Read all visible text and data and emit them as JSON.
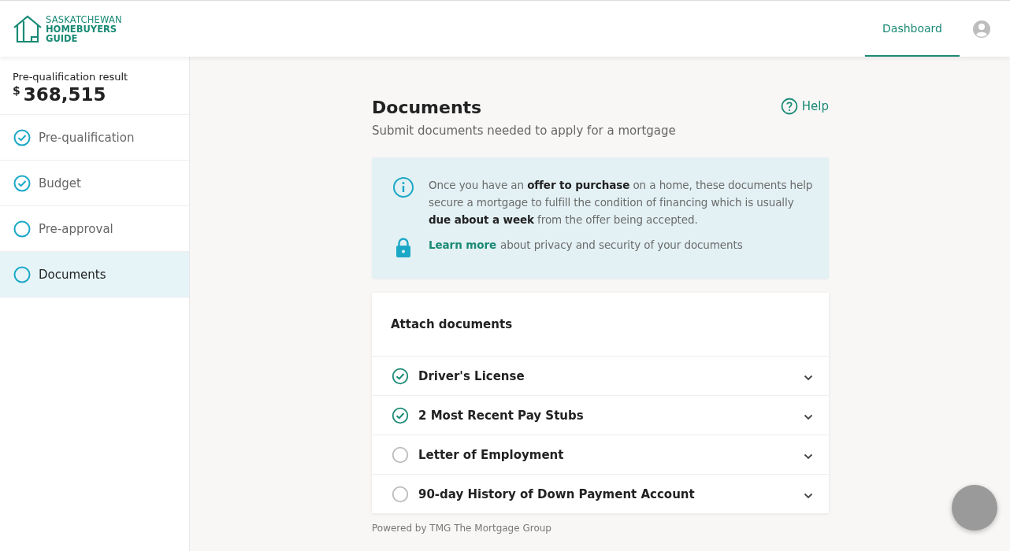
{
  "brand": {
    "line_1": "SASKATCHEWAN",
    "line_2": "HOMEBUYERS",
    "line_3": "GUIDE"
  },
  "nav": [
    {
      "label": "Dashboard",
      "selected": true
    }
  ],
  "sidebar": {
    "result_label": "Pre-qualification result",
    "currency": "$",
    "amount": "368,515",
    "items": [
      {
        "label": "Pre-qualification",
        "done": true,
        "selected": false
      },
      {
        "label": "Budget",
        "done": true,
        "selected": false
      },
      {
        "label": "Pre-approval",
        "done": false,
        "selected": false
      },
      {
        "label": "Documents",
        "done": false,
        "selected": true
      }
    ]
  },
  "page": {
    "title": "Documents",
    "subtitle": "Submit documents needed to apply for a mortgage",
    "help": "Help"
  },
  "notice": {
    "text": "Once you have an **offer to purchase** on a home, these documents help secure a mortgage to fulfill the condition of financing which is usually **due about a week** from the offer being accepted.",
    "link": "Learn more",
    "link_text": "about privacy and security of your documents"
  },
  "attach": {
    "title": "Attach documents",
    "items": [
      {
        "label": "Driver's License",
        "done": true
      },
      {
        "label": "2 Most Recent Pay Stubs",
        "done": true
      },
      {
        "label": "Letter of Employment",
        "done": false
      },
      {
        "label": "90-day History of Down Payment Account",
        "done": false
      }
    ]
  },
  "footer": {
    "powered_by": "Powered by TMG The Mortgage Group"
  }
}
